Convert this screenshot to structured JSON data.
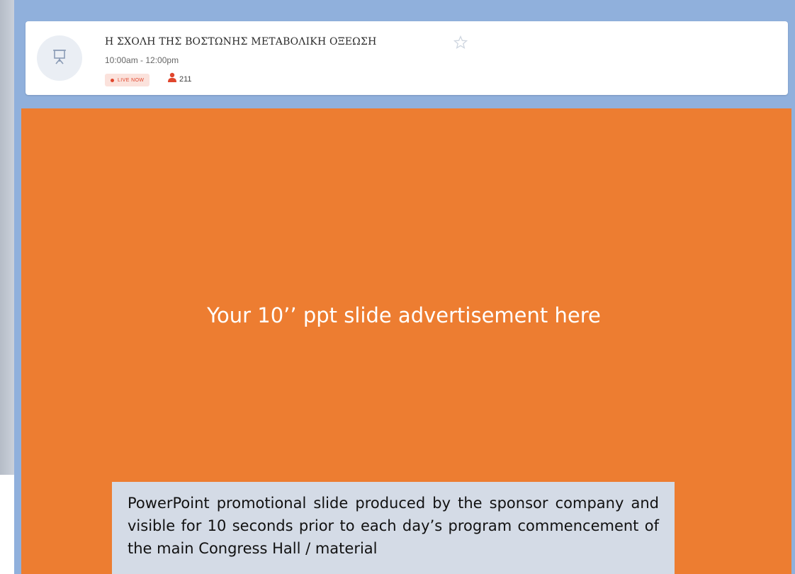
{
  "session": {
    "title": "Η ΣΧΟΛΗ ΤΗΣ ΒΟΣΤΩΝΗΣ ΜΕΤΑΒΟΛΙΚΗ ΟΞΕΩΣΗ",
    "time": "10:00am - 12:00pm",
    "live_label": "LIVE NOW",
    "viewer_count": "211",
    "icon": "presentation-board-icon"
  },
  "slide": {
    "headline": "Your 10’’ ppt slide advertisement here",
    "caption": "PowerPoint promotional slide produced by the sponsor company and visible for 10 seconds  prior  to each day’s program commencement of the main Congress Hall  / material"
  },
  "colors": {
    "frame": "#90b0dc",
    "slide_background": "#ed7d31",
    "caption_background": "#d4dbe6",
    "live_accent": "#e0452c"
  }
}
